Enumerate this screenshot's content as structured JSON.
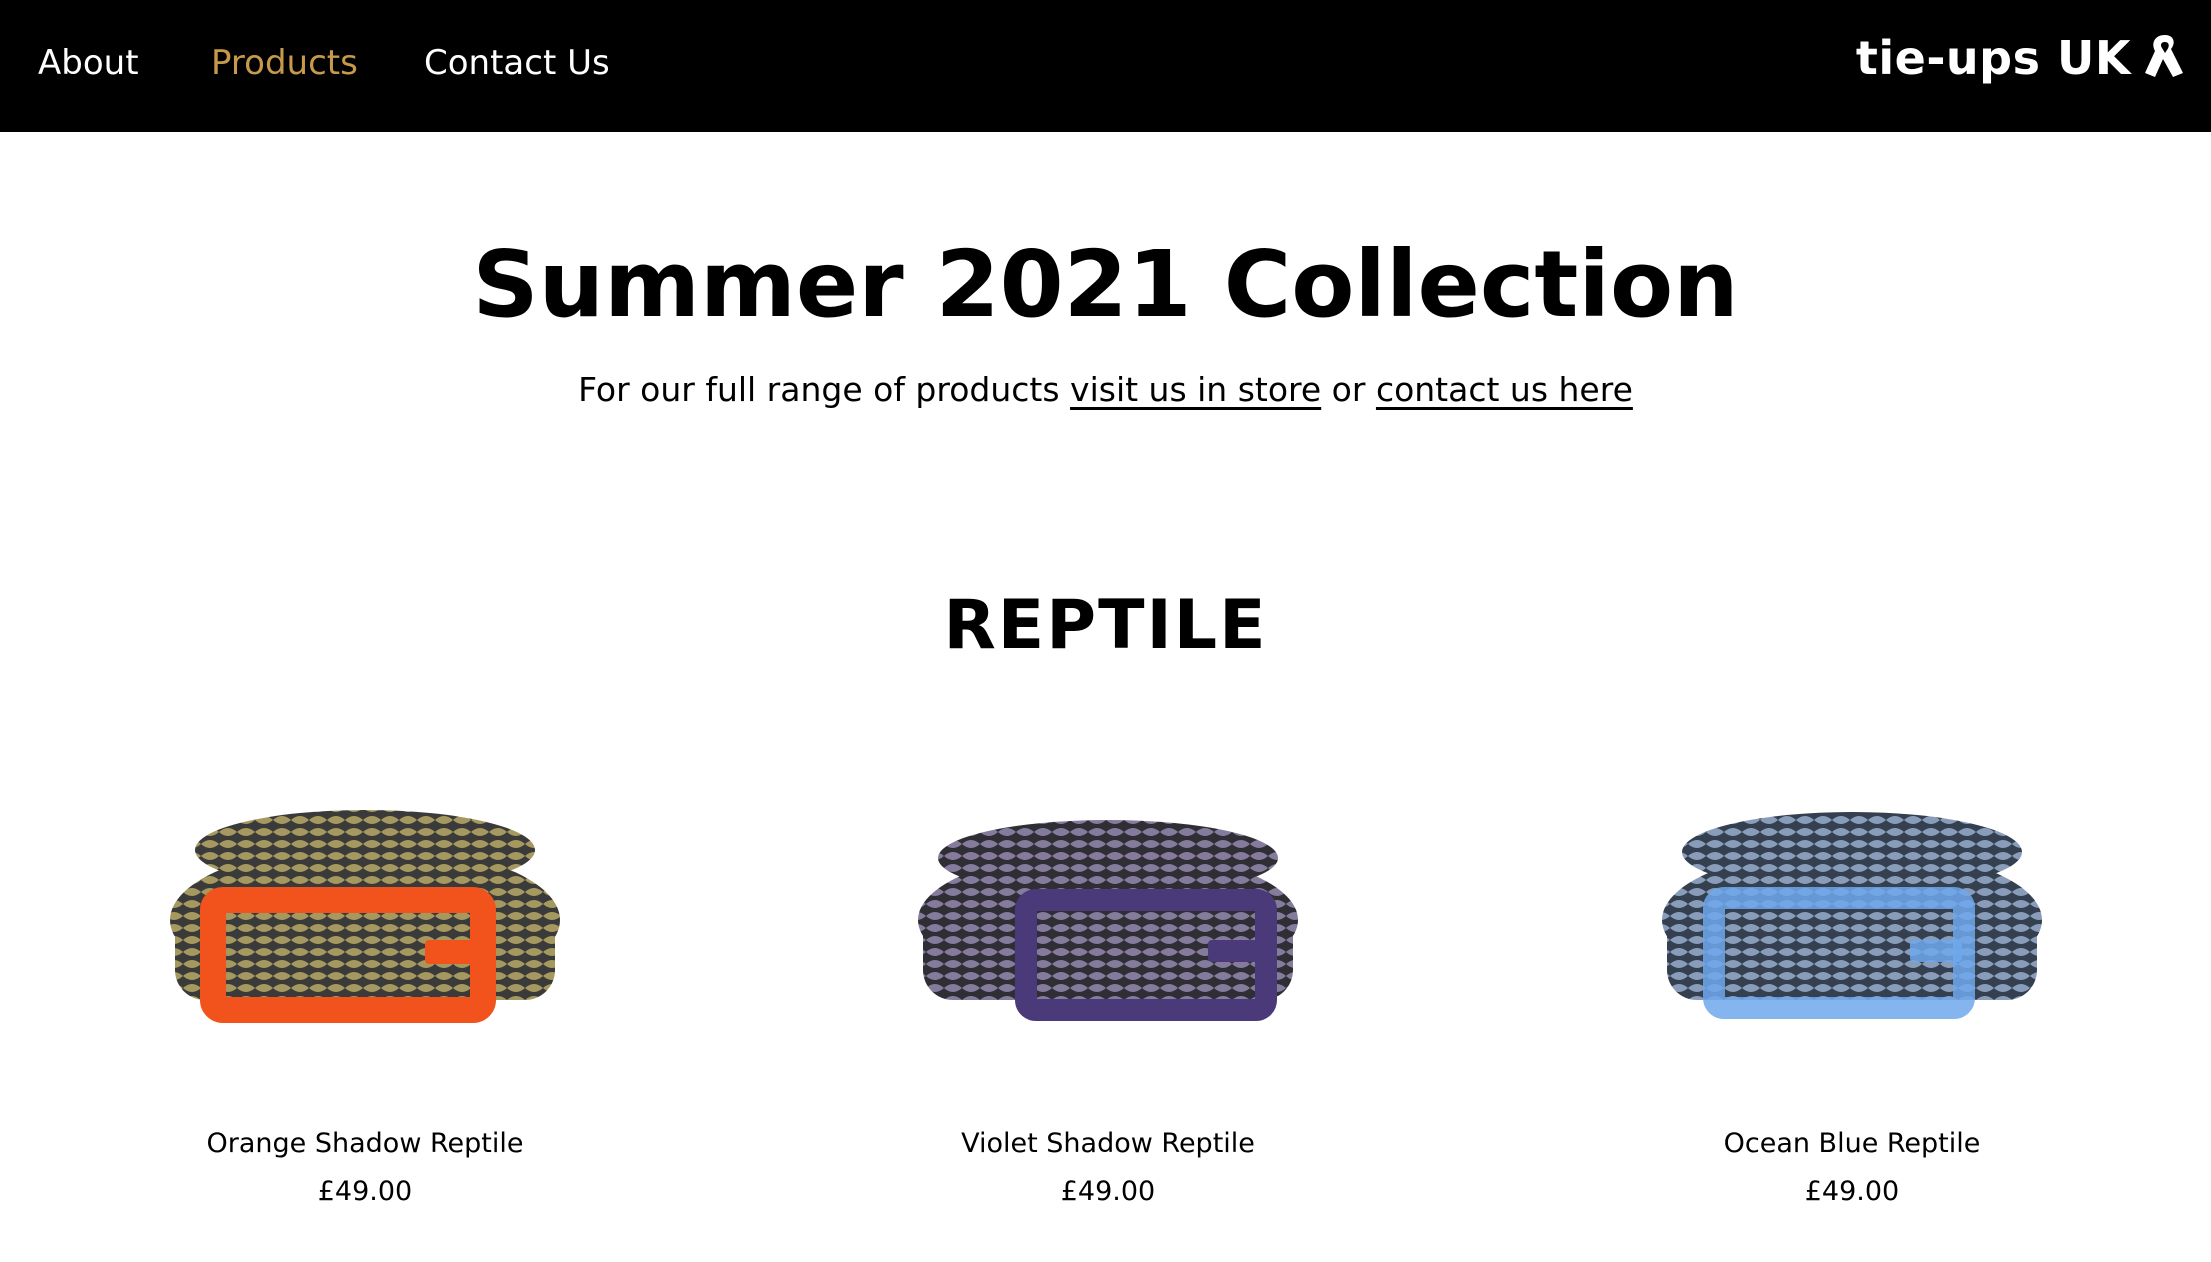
{
  "nav": {
    "items": [
      {
        "label": "About"
      },
      {
        "label": "Products",
        "active": true
      },
      {
        "label": "Contact Us"
      }
    ],
    "logo_text": "tie-ups UK",
    "active_color": "#c79a4b",
    "background": "#000000"
  },
  "hero": {
    "title": "Summer 2021 Collection",
    "sub_before": "For our full range of products ",
    "sub_link1": "visit us in store",
    "sub_middle": " or ",
    "sub_link2": "contact us here"
  },
  "section": {
    "title": "REPTILE"
  },
  "products": [
    {
      "name": "Orange Shadow Reptile",
      "price": "£49.00",
      "buckle_color": "#f2531c"
    },
    {
      "name": "Violet Shadow Reptile",
      "price": "£49.00",
      "buckle_color": "#4a3a7a"
    },
    {
      "name": "Ocean Blue Reptile",
      "price": "£49.00",
      "buckle_color": "#6fa8ec"
    }
  ]
}
